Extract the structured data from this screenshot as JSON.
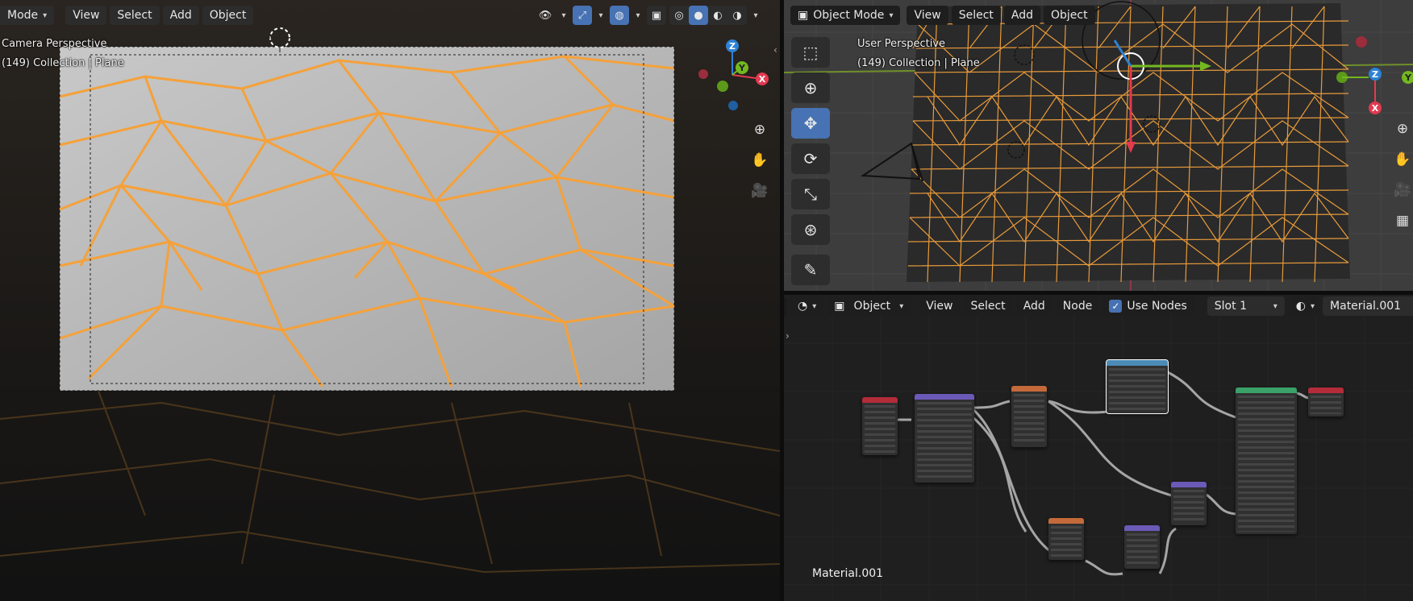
{
  "left_viewport": {
    "header": {
      "mode_label": "Mode",
      "menu": [
        "View",
        "Select",
        "Add",
        "Object"
      ]
    },
    "overlay": {
      "perspective": "Camera Perspective",
      "collection": "(149) Collection | Plane"
    },
    "gizmo": {
      "x": "X",
      "y": "Y",
      "z": "Z"
    }
  },
  "right_viewport": {
    "header": {
      "mode_label": "Object Mode",
      "menu": [
        "View",
        "Select",
        "Add",
        "Object"
      ]
    },
    "overlay": {
      "perspective": "User Perspective",
      "collection": "(149) Collection | Plane"
    },
    "gizmo": {
      "x": "X",
      "y": "Y",
      "z": "Z"
    },
    "tools": [
      "select-box",
      "cursor",
      "move",
      "rotate",
      "scale",
      "transform",
      "annotate"
    ]
  },
  "node_editor": {
    "header": {
      "object_label": "Object",
      "menu": [
        "View",
        "Select",
        "Add",
        "Node"
      ],
      "use_nodes_label": "Use Nodes",
      "use_nodes_checked": true,
      "slot_label": "Slot 1",
      "material_name": "Material.001"
    },
    "material_label": "Material.001"
  },
  "colors": {
    "accent": "#4772b3",
    "wire": "#f59a29",
    "axis_x": "#e23a4f",
    "axis_y": "#74b81f",
    "axis_z": "#2d82d6"
  }
}
